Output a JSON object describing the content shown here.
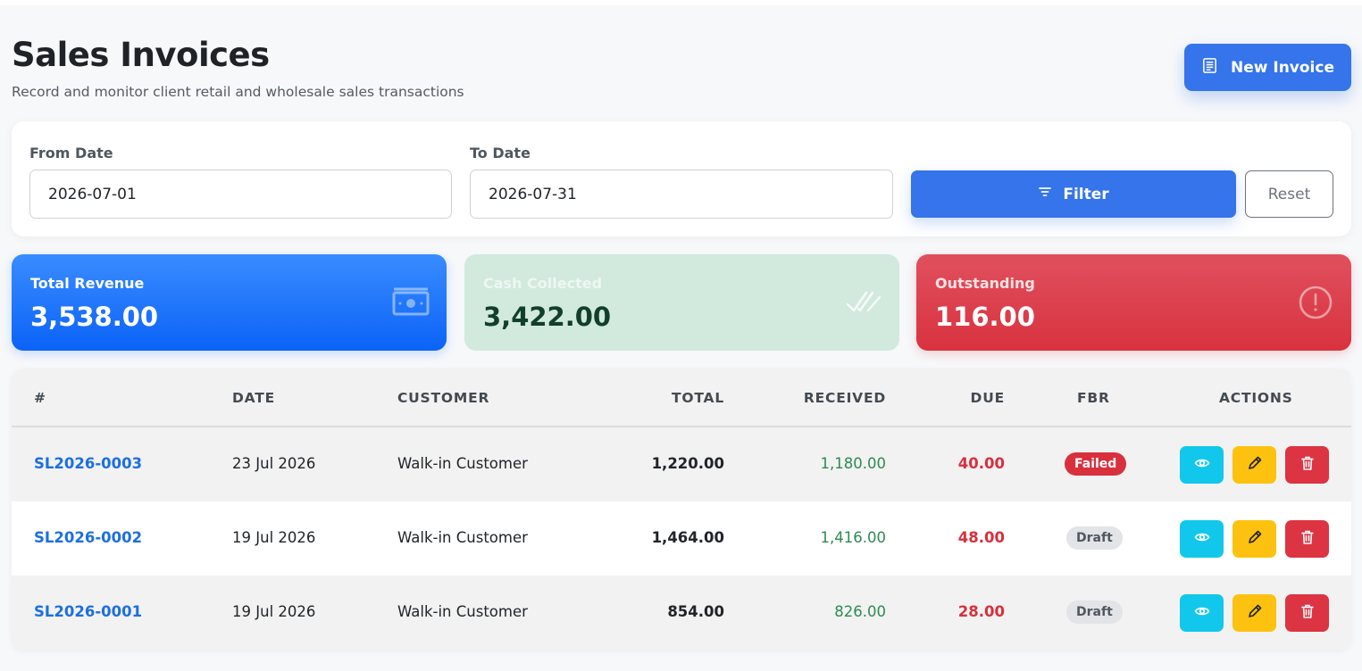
{
  "header": {
    "title": "Sales Invoices",
    "subtitle": "Record and monitor client retail and wholesale sales transactions",
    "new_invoice_label": "New Invoice"
  },
  "filters": {
    "from_label": "From Date",
    "from_value": "2026-07-01",
    "to_label": "To Date",
    "to_value": "2026-07-31",
    "filter_label": "Filter",
    "reset_label": "Reset"
  },
  "stats": {
    "revenue": {
      "label": "Total Revenue",
      "value": "3,538.00"
    },
    "collected": {
      "label": "Cash Collected",
      "value": "3,422.00"
    },
    "outstanding": {
      "label": "Outstanding",
      "value": "116.00"
    }
  },
  "table": {
    "columns": [
      "#",
      "DATE",
      "CUSTOMER",
      "TOTAL",
      "RECEIVED",
      "DUE",
      "FBR",
      "ACTIONS"
    ],
    "rows": [
      {
        "number": "SL2026-0003",
        "date": "23 Jul 2026",
        "customer": "Walk-in Customer",
        "total": "1,220.00",
        "received": "1,180.00",
        "due": "40.00",
        "fbr": "Failed"
      },
      {
        "number": "SL2026-0002",
        "date": "19 Jul 2026",
        "customer": "Walk-in Customer",
        "total": "1,464.00",
        "received": "1,416.00",
        "due": "48.00",
        "fbr": "Draft"
      },
      {
        "number": "SL2026-0001",
        "date": "19 Jul 2026",
        "customer": "Walk-in Customer",
        "total": "854.00",
        "received": "826.00",
        "due": "28.00",
        "fbr": "Draft"
      }
    ]
  },
  "icons": {
    "new_invoice": "receipt-icon",
    "filter": "filter-icon",
    "revenue": "money-icon",
    "collected": "double-check-icon",
    "outstanding": "exclamation-circle-icon",
    "view": "eye-icon",
    "edit": "pencil-icon",
    "delete": "trash-icon"
  },
  "colors": {
    "primary": "#3574ea",
    "link": "#1d6fe0",
    "success": "#2f8a55",
    "danger": "#d7303d",
    "info": "#12c7ec",
    "warning": "#fcc20f"
  }
}
